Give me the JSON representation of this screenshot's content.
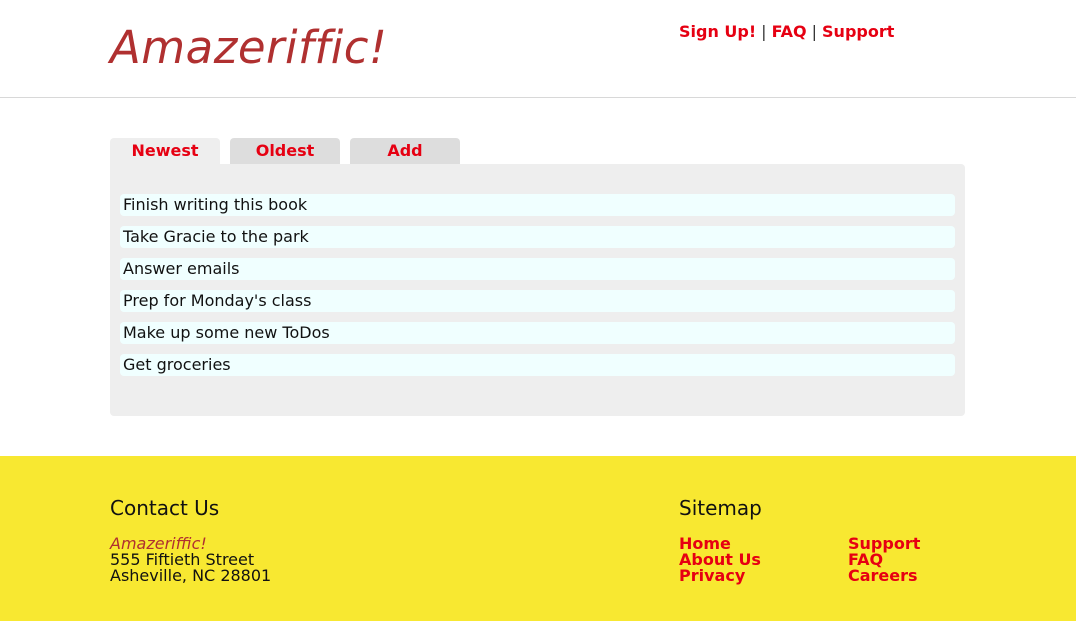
{
  "header": {
    "logo": "Amazeriffic!",
    "nav": {
      "signup": "Sign Up!",
      "faq": "FAQ",
      "support": "Support",
      "separator": "|"
    }
  },
  "tabs": [
    {
      "label": "Newest",
      "active": true
    },
    {
      "label": "Oldest",
      "active": false
    },
    {
      "label": "Add",
      "active": false
    }
  ],
  "todos": [
    "Finish writing this book",
    "Take Gracie to the park",
    "Answer emails",
    "Prep for Monday's class",
    "Make up some new ToDos",
    "Get groceries"
  ],
  "footer": {
    "contact": {
      "heading": "Contact Us",
      "company": "Amazeriffic!",
      "street": "555 Fiftieth Street",
      "city": "Asheville, NC 28801"
    },
    "sitemap": {
      "heading": "Sitemap",
      "col1": [
        "Home",
        "About Us",
        "Privacy"
      ],
      "col2": [
        "Support",
        "FAQ",
        "Careers"
      ]
    }
  },
  "colors": {
    "logo": "#b03030",
    "link": "#e60012",
    "footer_bg": "#f8e831",
    "panel_bg": "#eeeeee",
    "todo_bg": "#f0ffff"
  }
}
